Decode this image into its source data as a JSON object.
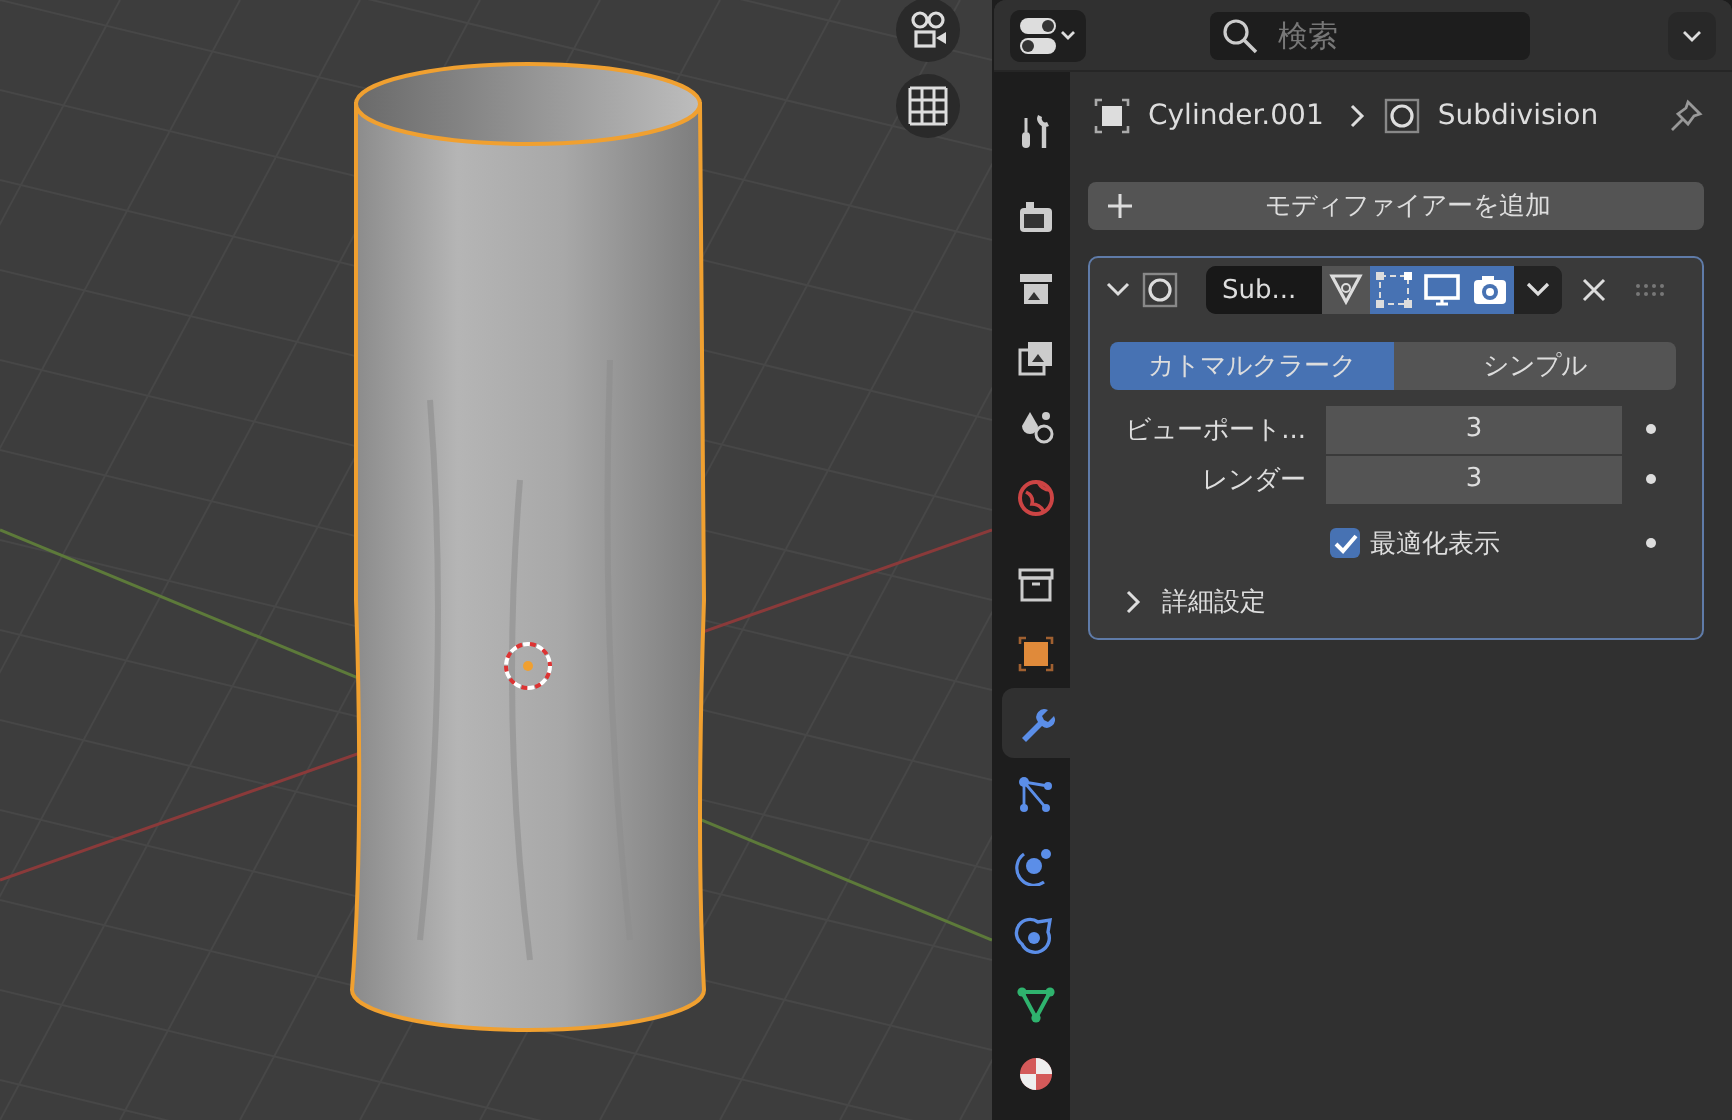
{
  "viewport": {
    "gizmos": [
      {
        "kind": "camera"
      },
      {
        "kind": "grid"
      }
    ]
  },
  "properties": {
    "header": {
      "search": {
        "placeholder": "検索"
      }
    },
    "tabs": [
      {
        "kind": "tool",
        "selected": false
      },
      {
        "kind": "render",
        "selected": false
      },
      {
        "kind": "output",
        "selected": false
      },
      {
        "kind": "view_layer",
        "selected": false
      },
      {
        "kind": "scene",
        "selected": false
      },
      {
        "kind": "world",
        "selected": false
      },
      {
        "kind": "collection",
        "selected": false
      },
      {
        "kind": "object",
        "selected": false
      },
      {
        "kind": "modifier",
        "selected": true
      },
      {
        "kind": "particles",
        "selected": false
      },
      {
        "kind": "physics",
        "selected": false
      },
      {
        "kind": "constraints",
        "selected": false
      },
      {
        "kind": "data",
        "selected": false
      },
      {
        "kind": "material",
        "selected": false
      }
    ],
    "breadcrumb": [
      {
        "kind": "object",
        "label": "Cylinder.001"
      },
      {
        "kind": "modifier",
        "label": "Subdivision"
      }
    ],
    "add_modifier": {
      "label": "モディファイアーを追加"
    },
    "modifier": {
      "name": "Sub...",
      "expanded": true,
      "toggles": [
        {
          "kind": "cage",
          "on": false
        },
        {
          "kind": "editmode",
          "on": true
        },
        {
          "kind": "viewport",
          "on": true
        },
        {
          "kind": "render",
          "on": true
        }
      ],
      "modes": [
        {
          "label": "カトマルクラーク",
          "selected": true
        },
        {
          "label": "シンプル",
          "selected": false
        }
      ],
      "fields": [
        {
          "label": "ビューポート...",
          "value": "3"
        },
        {
          "label": "レンダー",
          "value": "3"
        }
      ],
      "checkbox": {
        "label": "最適化表示",
        "checked": true
      },
      "subpanel": {
        "label": "詳細設定",
        "expanded": false
      }
    }
  }
}
